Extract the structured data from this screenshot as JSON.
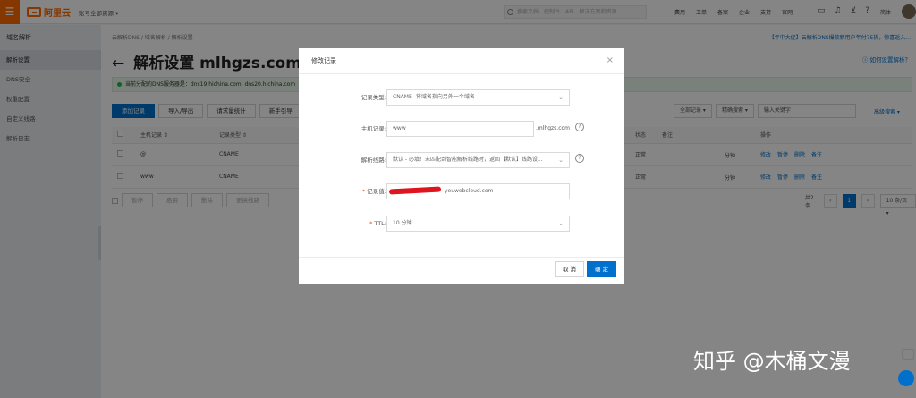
{
  "topbar": {
    "logo": "阿里云",
    "account": "账号全部资源 ▾",
    "search_placeholder": "搜索文档、控制台、API、解决方案和资源",
    "nav": [
      "费用",
      "工单",
      "备案",
      "企业",
      "支持",
      "官网"
    ],
    "user": "简体"
  },
  "sidebar": {
    "title": "域名解析",
    "items": [
      {
        "label": "解析设置",
        "active": true
      },
      {
        "label": "DNS安全",
        "active": false
      },
      {
        "label": "权重配置",
        "active": false
      },
      {
        "label": "自定义线路",
        "active": false
      },
      {
        "label": "解析日志",
        "active": false
      }
    ]
  },
  "main": {
    "breadcrumb": "云解析DNS  /  域名解析  /  解析设置",
    "promo": "【年中大促】云解析DNS爆款新用户年付75折，惊喜返入...",
    "help": "如何设置解析？",
    "title": "解析设置 mlhgzs.com",
    "dns_notice": "当前分配的DNS服务器是：dns19.hichina.com, dns20.hichina.com",
    "buttons": [
      "添加记录",
      "导入/导出",
      "请求量统计",
      "新手引导"
    ],
    "filters": [
      "全部记录",
      "精确搜索",
      "输入关键字"
    ],
    "advanced": "高级搜索 ▾",
    "columns": [
      "主机记录 ⇕",
      "记录类型 ⇕",
      "状态",
      "备注",
      "操作"
    ],
    "rows": [
      {
        "host": "@",
        "type": "CNAME",
        "ttl": "分钟",
        "status": "正常"
      },
      {
        "host": "www",
        "type": "CNAME",
        "ttl": "分钟",
        "status": "正常"
      }
    ],
    "ops": [
      "修改",
      "暂停",
      "删除",
      "备注"
    ],
    "bulk": [
      "暂停",
      "启用",
      "删除",
      "更换线路"
    ],
    "pager": {
      "total": "共2条",
      "current": "1",
      "size": "10 条/页"
    }
  },
  "dialog": {
    "title": "修改记录",
    "fields": [
      {
        "label": "记录类型:",
        "value": "CNAME- 将域名指向另外一个域名",
        "required": false
      },
      {
        "label": "主机记录:",
        "value": "www",
        "suffix": ".mlhgzs.com",
        "required": false
      },
      {
        "label": "解析线路:",
        "value": "默认 - 必填！未匹配到智能解析线路时，返回【默认】线路设...",
        "required": false
      },
      {
        "label": "记录值:",
        "value": "youwebcloud.com",
        "required": true
      },
      {
        "label": "TTL:",
        "value": "10 分钟",
        "required": true
      }
    ],
    "cancel": "取 消",
    "confirm": "确 定"
  },
  "watermark": "知乎 @木桶文漫"
}
